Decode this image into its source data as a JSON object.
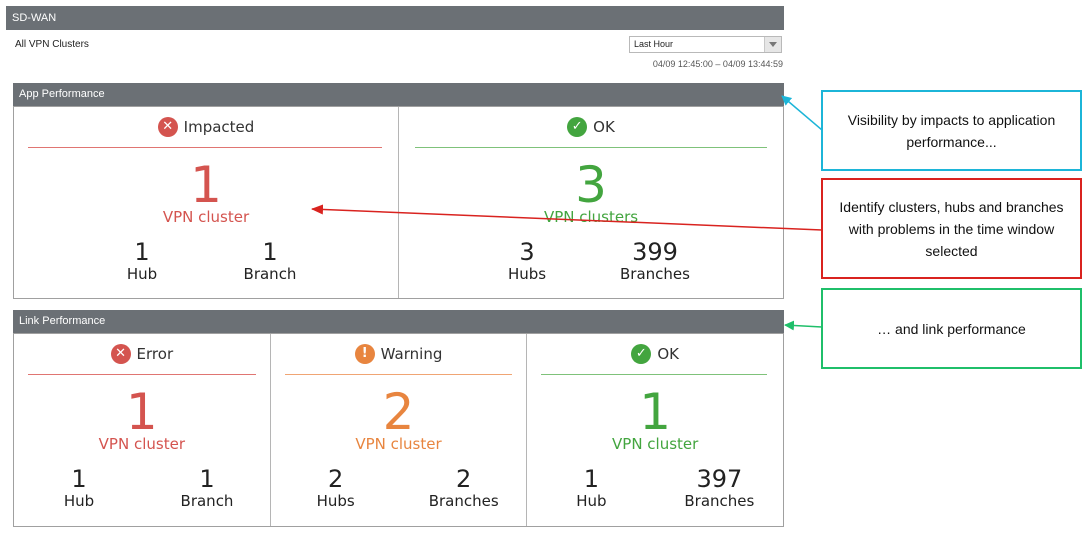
{
  "header": {
    "title": "SD-WAN",
    "subtitle": "All VPN Clusters",
    "time_select": "Last Hour",
    "time_range": "04/09 12:45:00 – 04/09 13:44:59"
  },
  "app_performance": {
    "title": "App Performance",
    "cards": [
      {
        "status": "Impacted",
        "icon": "error-icon",
        "count": "1",
        "unit": "VPN cluster",
        "stats": [
          {
            "n": "1",
            "l": "Hub"
          },
          {
            "n": "1",
            "l": "Branch"
          }
        ]
      },
      {
        "status": "OK",
        "icon": "check-icon",
        "count": "3",
        "unit": "VPN clusters",
        "stats": [
          {
            "n": "3",
            "l": "Hubs"
          },
          {
            "n": "399",
            "l": "Branches"
          }
        ]
      }
    ]
  },
  "link_performance": {
    "title": "Link Performance",
    "cards": [
      {
        "status": "Error",
        "icon": "error-icon",
        "count": "1",
        "unit": "VPN cluster",
        "stats": [
          {
            "n": "1",
            "l": "Hub"
          },
          {
            "n": "1",
            "l": "Branch"
          }
        ]
      },
      {
        "status": "Warning",
        "icon": "warning-icon",
        "count": "2",
        "unit": "VPN cluster",
        "stats": [
          {
            "n": "2",
            "l": "Hubs"
          },
          {
            "n": "2",
            "l": "Branches"
          }
        ]
      },
      {
        "status": "OK",
        "icon": "check-icon",
        "count": "1",
        "unit": "VPN cluster",
        "stats": [
          {
            "n": "1",
            "l": "Hub"
          },
          {
            "n": "397",
            "l": "Branches"
          }
        ]
      }
    ]
  },
  "callouts": {
    "visibility": "Visibility by impacts to application performance...",
    "identify": "Identify clusters, hubs and branches with problems in the time window selected",
    "link": "… and link performance"
  },
  "colors": {
    "error": "#d4544f",
    "ok": "#43a53f",
    "warning": "#e8853f",
    "callout_cyan": "#1cb5d8",
    "callout_red": "#d9231f",
    "callout_green": "#1fbf6a",
    "header_bar": "#6b7075"
  },
  "glyphs": {
    "error": "✕",
    "warning": "!",
    "check": "✓"
  }
}
